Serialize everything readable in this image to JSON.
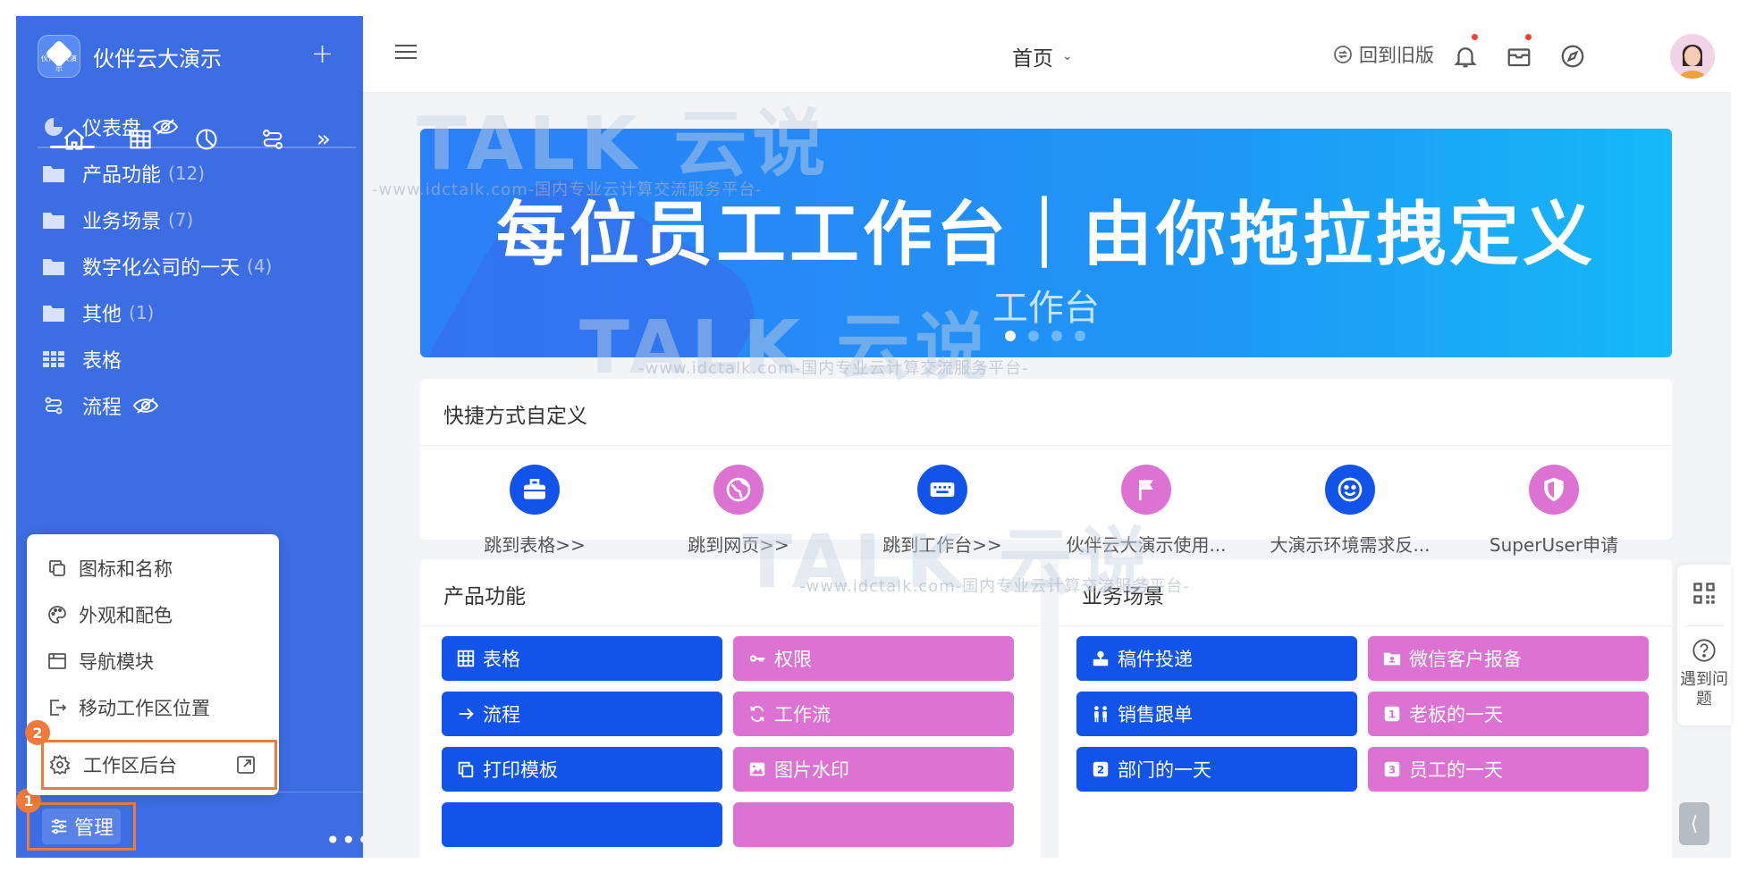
{
  "sidebar": {
    "brand": {
      "name": "伙伴云大演示",
      "logo_caption": "伙伴云大演示"
    },
    "tabs": [
      "home-icon",
      "table-icon",
      "chart-icon",
      "flow-icon"
    ],
    "nav": [
      {
        "label": "仪表盘",
        "icon": "dashboard-icon",
        "count": "",
        "hidden": true
      },
      {
        "label": "产品功能",
        "icon": "folder-icon",
        "count": "(12)",
        "hidden": false
      },
      {
        "label": "业务场景",
        "icon": "folder-icon",
        "count": "(7)",
        "hidden": false
      },
      {
        "label": "数字化公司的一天",
        "icon": "folder-icon",
        "count": "(4)",
        "hidden": false
      },
      {
        "label": "其他",
        "icon": "folder-icon",
        "count": "(1)",
        "hidden": false
      },
      {
        "label": "表格",
        "icon": "table-icon",
        "count": "",
        "hidden": false
      },
      {
        "label": "流程",
        "icon": "flow-icon",
        "count": "",
        "hidden": true
      }
    ],
    "manage_label": "管理",
    "more_label": "•••",
    "badge_1": "1",
    "badge_2": "2"
  },
  "popup_menu": {
    "items": [
      {
        "label": "图标和名称",
        "icon": "copy-icon"
      },
      {
        "label": "外观和配色",
        "icon": "palette-icon"
      },
      {
        "label": "导航模块",
        "icon": "nav-module-icon"
      },
      {
        "label": "移动工作区位置",
        "icon": "move-icon"
      }
    ],
    "admin_label": "工作区后台"
  },
  "header": {
    "title": "首页",
    "old_version": "回到旧版"
  },
  "banner": {
    "headline": "每位员工工作台｜由你拖拉拽定义",
    "subtitle": "工作台",
    "slides": 4,
    "active_slide": 1
  },
  "shortcuts": {
    "title": "快捷方式自定义",
    "items": [
      {
        "label": "跳到表格>>",
        "icon": "briefcase-icon",
        "color": "#1254ea"
      },
      {
        "label": "跳到网页>>",
        "icon": "globe-icon",
        "color": "#dc72d2"
      },
      {
        "label": "跳到工作台>>",
        "icon": "keyboard-icon",
        "color": "#1254ea"
      },
      {
        "label": "伙伴云大演示使用...",
        "icon": "flag-icon",
        "color": "#dc72d2"
      },
      {
        "label": "大演示环境需求反...",
        "icon": "smile-icon",
        "color": "#1254ea"
      },
      {
        "label": "SuperUser申请",
        "icon": "shield-icon",
        "color": "#dc72d2"
      }
    ]
  },
  "product_features": {
    "title": "产品功能",
    "items": [
      {
        "label": "表格",
        "icon": "grid-icon",
        "color": "blue"
      },
      {
        "label": "权限",
        "icon": "key-icon",
        "color": "pink"
      },
      {
        "label": "流程",
        "icon": "arrow-right-icon",
        "color": "blue"
      },
      {
        "label": "工作流",
        "icon": "sync-icon",
        "color": "pink"
      },
      {
        "label": "打印模板",
        "icon": "copy-icon",
        "color": "blue"
      },
      {
        "label": "图片水印",
        "icon": "image-icon",
        "color": "pink"
      }
    ]
  },
  "business_scenes": {
    "title": "业务场景",
    "items": [
      {
        "label": "稿件投递",
        "icon": "submit-icon",
        "color": "blue"
      },
      {
        "label": "微信客户报备",
        "icon": "contact-card-icon",
        "color": "pink"
      },
      {
        "label": "销售跟单",
        "icon": "people-icon",
        "color": "blue"
      },
      {
        "label": "老板的一天",
        "icon": "number-1-icon",
        "color": "pink"
      },
      {
        "label": "部门的一天",
        "icon": "number-2-icon",
        "color": "blue"
      },
      {
        "label": "员工的一天",
        "icon": "number-3-icon",
        "color": "pink"
      }
    ]
  },
  "side_float": {
    "help_label": "遇到问题"
  },
  "watermark": {
    "brand": "TALK 云说",
    "line": "-www.idctalk.com-国内专业云计算交流服务平台-"
  },
  "colors": {
    "sidebar": "#3d6de3",
    "blue": "#1254ea",
    "pink": "#dc72d2",
    "annotation": "#ef7a3c"
  }
}
